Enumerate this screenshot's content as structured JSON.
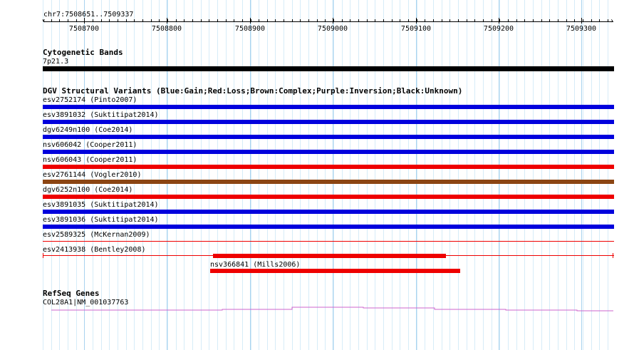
{
  "ruler": {
    "location": "chr7:7508651..7509337",
    "ticks": [
      "7508700",
      "7508800",
      "7508900",
      "7509000",
      "7509100",
      "7509200",
      "7509300"
    ]
  },
  "cytoband": {
    "title": "Cytogenetic Bands",
    "band_label": "7p21.3",
    "color": "#000000"
  },
  "dgv": {
    "title": "DGV Structural Variants (Blue:Gain;Red:Loss;Brown:Complex;Purple:Inversion;Black:Unknown)",
    "colors": {
      "gain": "#0000dd",
      "loss": "#ee0000",
      "complex": "#8b4513"
    },
    "variants": [
      {
        "label": "esv2752174 (Pinto2007)",
        "type": "gain"
      },
      {
        "label": "esv3891032 (Suktitipat2014)",
        "type": "gain"
      },
      {
        "label": "dgv6249n100 (Coe2014)",
        "type": "gain"
      },
      {
        "label": "nsv606042 (Cooper2011)",
        "type": "gain"
      },
      {
        "label": "nsv606043 (Cooper2011)",
        "type": "loss"
      },
      {
        "label": "esv2761144 (Vogler2010)",
        "type": "complex"
      },
      {
        "label": "dgv6252n100 (Coe2014)",
        "type": "loss"
      },
      {
        "label": "esv3891035 (Suktitipat2014)",
        "type": "gain"
      },
      {
        "label": "esv3891036 (Suktitipat2014)",
        "type": "gain"
      },
      {
        "label": "esv2589325 (McKernan2009)",
        "type": "loss"
      },
      {
        "label": "esv2413938 (Bentley2008)",
        "type": "loss"
      },
      {
        "label": "nsv366841 (Mills2006)",
        "type": "loss"
      }
    ]
  },
  "refseq": {
    "title": "RefSeq Genes",
    "gene_label": "COL28A1|NM_001037763",
    "color": "#cc66cc"
  }
}
